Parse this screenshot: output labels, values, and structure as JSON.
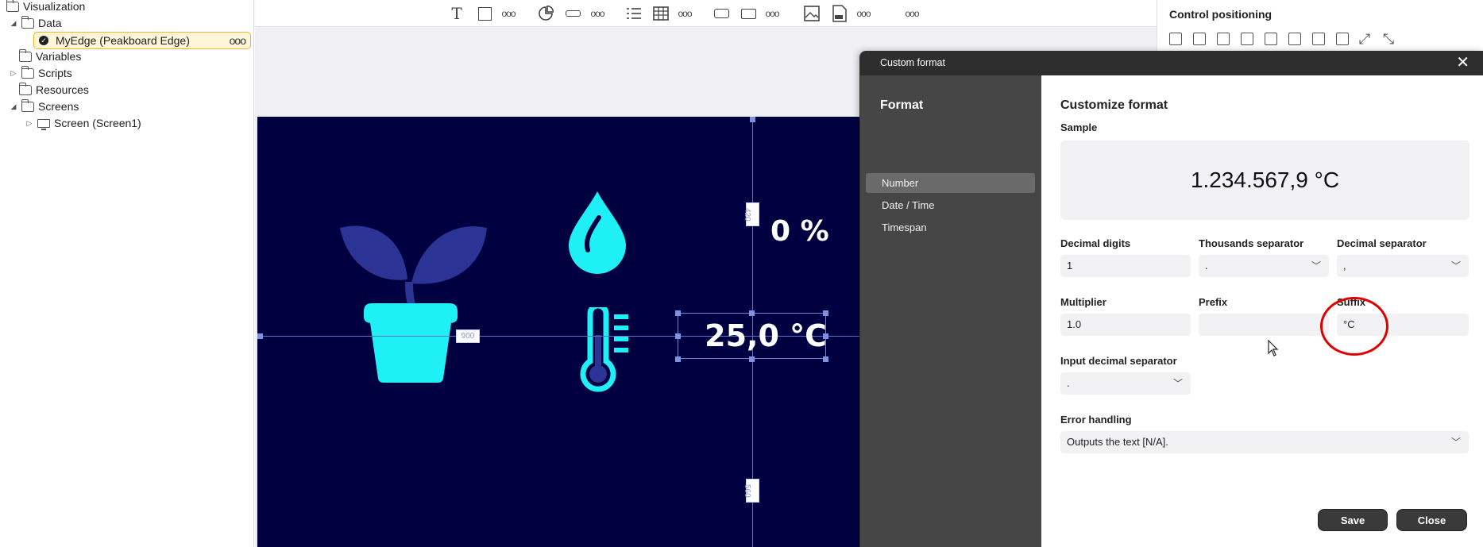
{
  "tree": {
    "visualization": "Visualization",
    "data": "Data",
    "myedge": "MyEdge (Peakboard Edge)",
    "myedge_more": "ooo",
    "variables": "Variables",
    "scripts": "Scripts",
    "resources": "Resources",
    "screens": "Screens",
    "screen1": "Screen (Screen1)"
  },
  "toolbar": {
    "text_icon": "T",
    "more": "ooo"
  },
  "canvas": {
    "humidity_value": "0 %",
    "temperature_value": "25,0 °C",
    "dim_top": "420",
    "dim_left": "900",
    "dim_bottom": "560",
    "background_color": "#000040",
    "icon_color": "#1ef0f5",
    "leaf_color": "#2b3395"
  },
  "right_panel": {
    "title": "Control positioning"
  },
  "dialog": {
    "title": "Custom format",
    "close_glyph": "✕",
    "nav": {
      "title": "Format",
      "items": [
        {
          "label": "Number",
          "active": true
        },
        {
          "label": "Date / Time",
          "active": false
        },
        {
          "label": "Timespan",
          "active": false
        }
      ]
    },
    "main": {
      "heading": "Customize format",
      "sample_label": "Sample",
      "sample_value": "1.234.567,9 °C",
      "decimal_digits_label": "Decimal digits",
      "decimal_digits_value": "1",
      "thousands_separator_label": "Thousands separator",
      "thousands_separator_value": ".",
      "decimal_separator_label": "Decimal separator",
      "decimal_separator_value": ",",
      "multiplier_label": "Multiplier",
      "multiplier_value": "1.0",
      "prefix_label": "Prefix",
      "prefix_value": "",
      "suffix_label": "Suffix",
      "suffix_value": "°C",
      "input_decimal_separator_label": "Input decimal separator",
      "input_decimal_separator_value": ".",
      "error_handling_label": "Error handling",
      "error_handling_value": "Outputs the text [N/A].",
      "save_label": "Save",
      "close_label": "Close"
    }
  },
  "annotation_color": "#e00000"
}
